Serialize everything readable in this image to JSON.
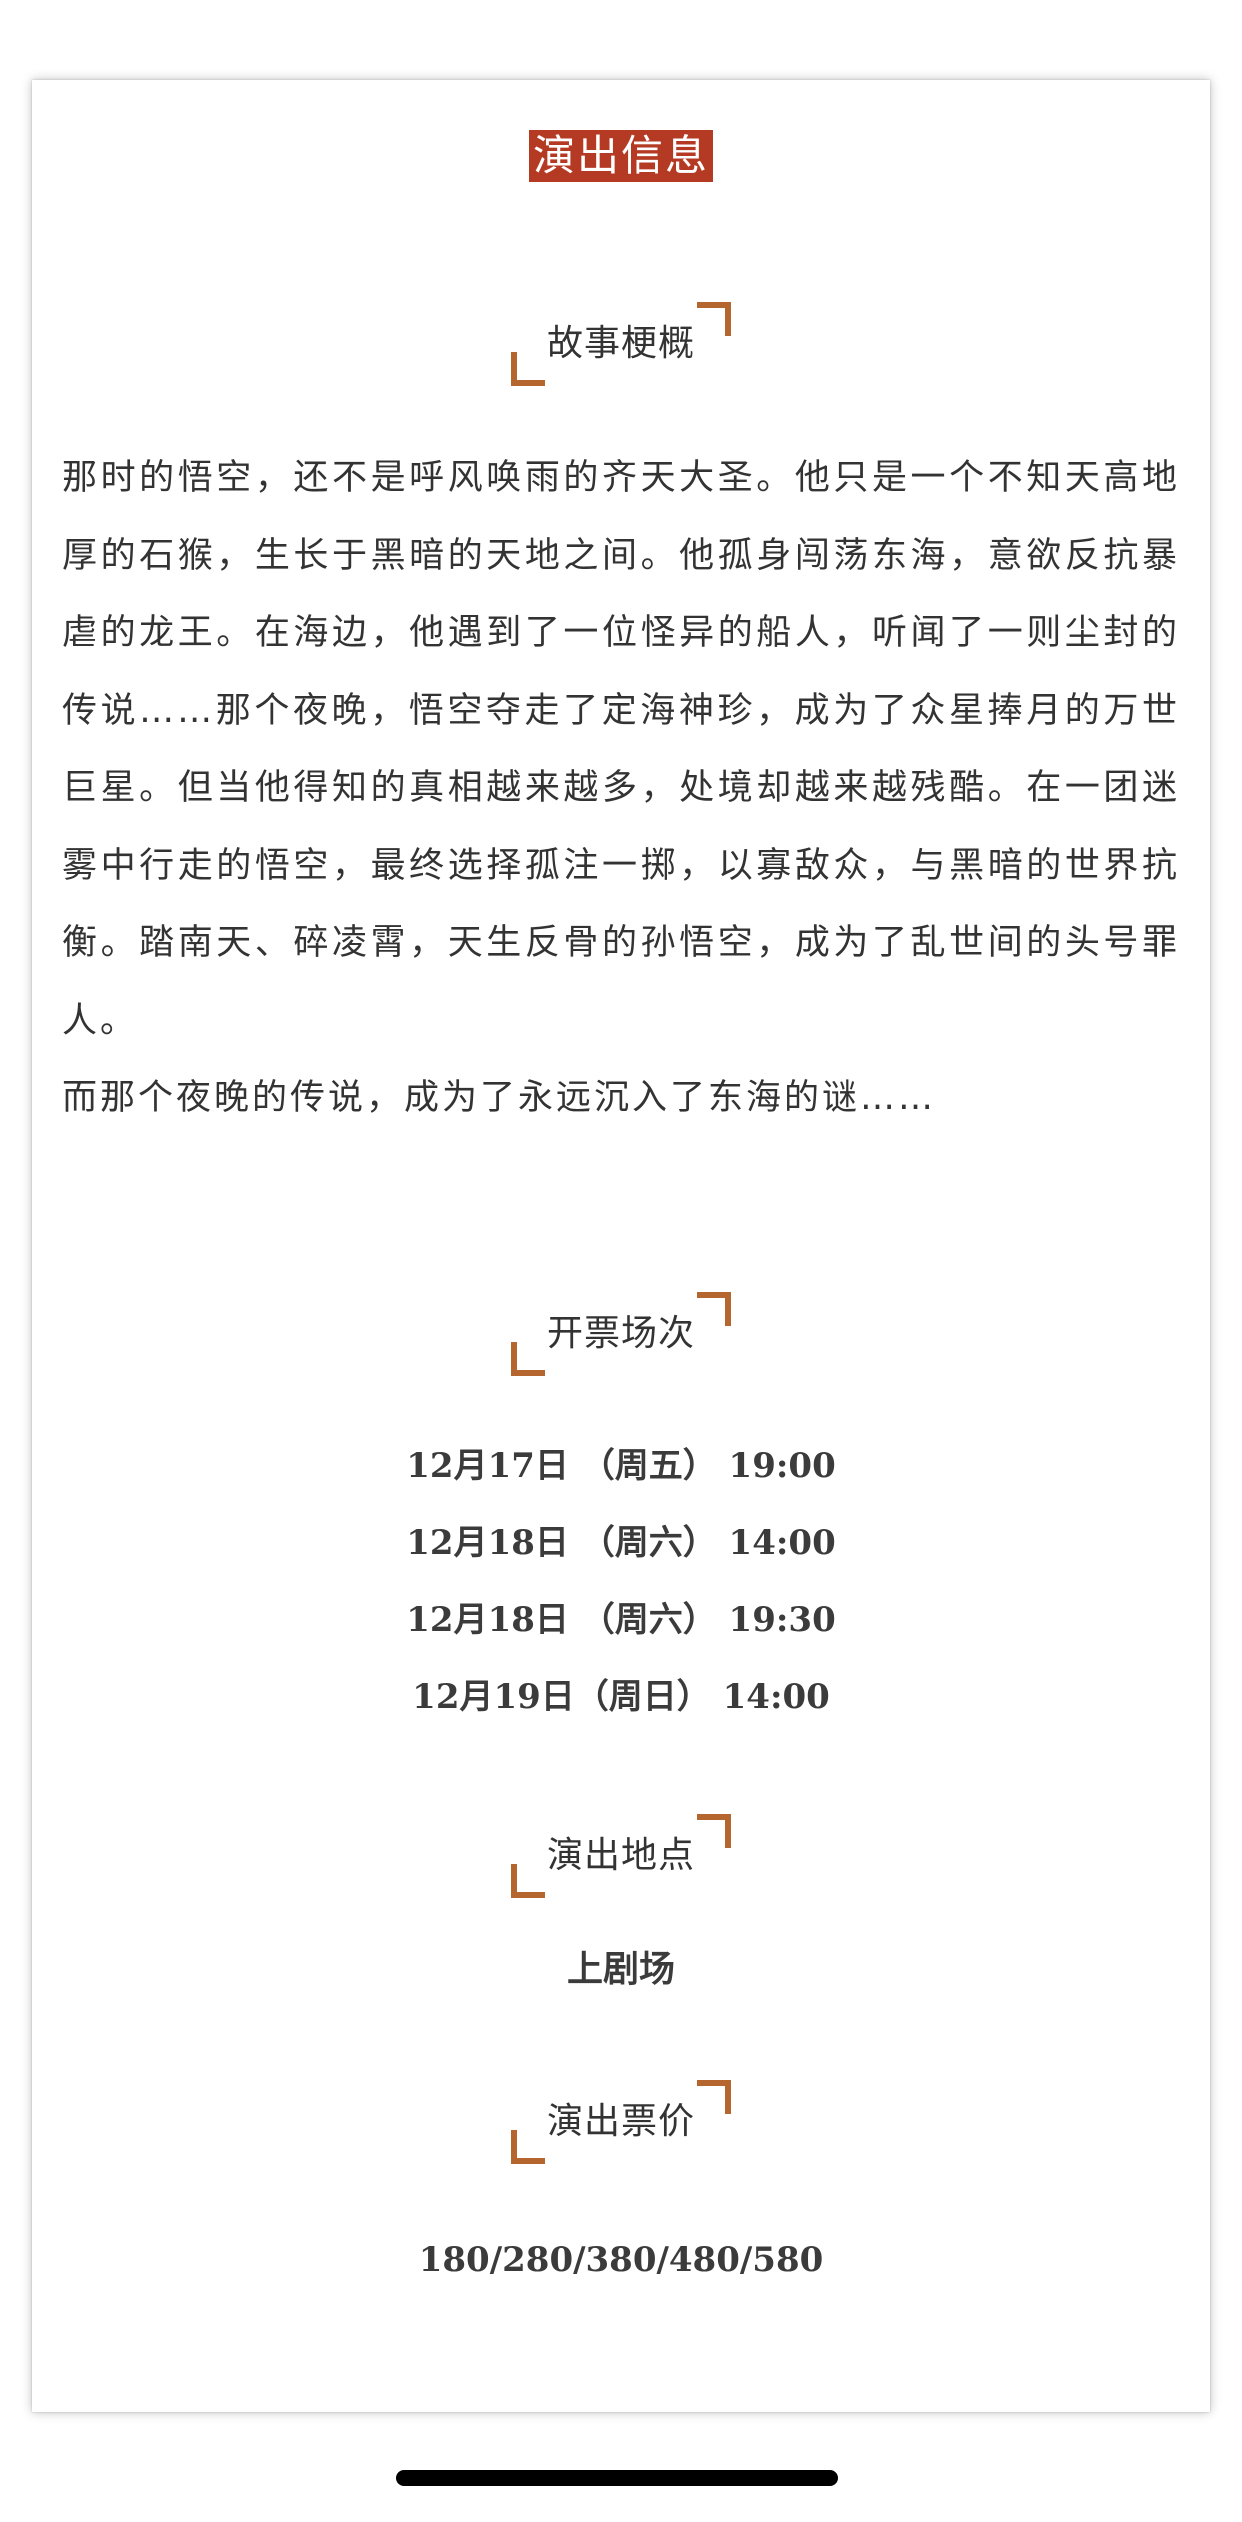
{
  "header": {
    "title": "演出信息"
  },
  "story": {
    "heading": "故事梗概",
    "paragraphs": [
      "那时的悟空，还不是呼风唤雨的齐天大圣。他只是一个不知天高地厚的石猴，生长于黑暗的天地之间。他孤身闯荡东海，意欲反抗暴虐的龙王。在海边，他遇到了一位怪异的船人，听闻了一则尘封的传说……那个夜晚，悟空夺走了定海神珍，成为了众星捧月的万世巨星。但当他得知的真相越来越多，处境却越来越残酷。在一团迷雾中行走的悟空，最终选择孤注一掷，以寡敌众，与黑暗的世界抗衡。踏南天、碎凌霄，天生反骨的孙悟空，成为了乱世间的头号罪人。",
      "而那个夜晚的传说，成为了永远沉入了东海的谜……"
    ]
  },
  "sessions": {
    "heading": "开票场次",
    "items": [
      "12月17日 （周五） 19:00",
      "12月18日 （周六） 14:00",
      "12月18日 （周六） 19:30",
      "12月19日（周日） 14:00"
    ]
  },
  "venue": {
    "heading": "演出地点",
    "name": "上剧场"
  },
  "price": {
    "heading": "演出票价",
    "value": "180/280/380/480/580"
  },
  "colors": {
    "title_background": "#b53a24",
    "corner_accent": "#b5652e",
    "text": "#333333"
  }
}
